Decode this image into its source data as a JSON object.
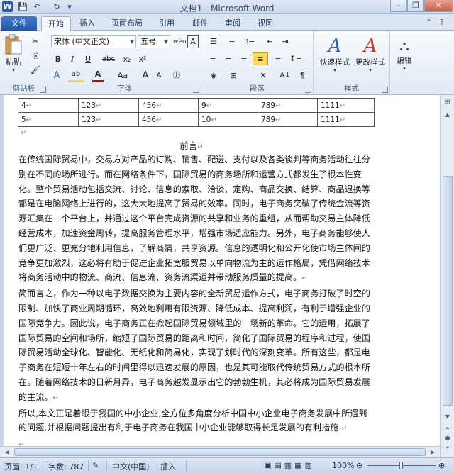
{
  "window": {
    "title": "文档1 - Microsoft Word",
    "logo": "W",
    "controls": {
      "minimize": "–",
      "restore": "❐",
      "close": "✕"
    }
  },
  "qat": {
    "save_icon": "💾",
    "undo_icon": "↶",
    "redo_icon": "↻",
    "customize_icon": "▾"
  },
  "tabs": [
    {
      "label": "文件"
    },
    {
      "label": "开始"
    },
    {
      "label": "插入"
    },
    {
      "label": "页面布局"
    },
    {
      "label": "引用"
    },
    {
      "label": "邮件"
    },
    {
      "label": "审阅"
    },
    {
      "label": "视图"
    }
  ],
  "ribbon": {
    "clipboard": {
      "label": "剪贴板",
      "paste": "粘贴",
      "cut_icon": "✂",
      "copy_icon": "⎘",
      "format_painter_icon": "🖌"
    },
    "font": {
      "label": "字体",
      "font_name": "宋体 (中文正文)",
      "font_size": "五号",
      "grow": "A",
      "shrink": "A",
      "pinyin": "wén",
      "char_border": "A",
      "bold": "B",
      "italic": "I",
      "underline": "U",
      "strike": "abc",
      "subscript": "x₂",
      "superscript": "x²",
      "highlight": "ab",
      "font_color": "A",
      "char_shade": "Aa",
      "enclose": "㊤"
    },
    "paragraph": {
      "label": "段落",
      "sort": "A↓",
      "show_marks": "¶"
    },
    "styles": {
      "label": "样式",
      "quick_styles": "快速样式",
      "change_styles": "更改样式"
    },
    "editing": {
      "label": "编辑",
      "find": "编辑"
    }
  },
  "table": {
    "rows": [
      [
        "4",
        "123",
        "456",
        "9",
        "789",
        "1111"
      ],
      [
        "5",
        "123",
        "456",
        "10",
        "789",
        "1111"
      ]
    ]
  },
  "document": {
    "heading": "前言",
    "paragraphs": [
      "在传统国际贸易中，交易方对产品的订购、销售、配送、支付以及各类谈判等商务活动往往分别在不同的场所进行。而在网络条件下，国际贸易的商务场所和运营方式都发生了根本性变化。整个贸易活动包括交流、讨论、信息的索取、洽谈、定购、商品交换、结算、商品退换等都是在电脑网络上进行的，这大大地提高了贸易的效率。同时，电子商务突破了传统金流等资源汇集在一个平台上，并通过这个平台完成资源的共享和业务的重组，从而帮助交易主体降低经营成本，加速资金周转，提高服务管理水平，增强市场适应能力。另外，电子商务能够使人们更广泛、更充分地利用信息，了解商情，共享资源。信息的透明化和公开化使市场主体间的竞争更加激烈，这必将有助于促进企业拓宽服贸易以单向物流为主的运作格局，凭借网络技术将商务活动中的物流、商流、信息流、资务流渠道并带动服务质量的提高。",
      "简而言之，作为一种以电子数据交换为主要内容的全新贸易运作方式，电子商务打破了时空的限制、加快了商业周期循环，高效地利用有限资源、降低成本、提高利润，有利于增强企业的国际竞争力。因此说，电子商务正在掀起国际贸易领域里的一场新的革命。它的运用，拓展了国际贸易的空间和场所，缩短了国际贸易的距离和时间，简化了国际贸易的程序和过程，使国际贸易活动全球化、智能化、无纸化和简易化，实现了划时代的深刻变革。所有这些，都是电子商务在短短十年左右的时间里得以迅速发展的原因，也是其可能取代传统贸易方式的根本所在。随着网络技术的日新月异，电子商务越发显示出它的勃勃生机，其必将成为国际贸易发展的主流。",
      "所以,本文正是着眼于我国的中小企业,全方位多角度分析中国中小企业电子商务发展中所遇到的问题,并根据问题提出有利于电子商务在我国中小企业能够取得长足发展的有利措施."
    ],
    "para_mark": "↵"
  },
  "statusbar": {
    "page": "页面: 1/1",
    "words": "字数: 787",
    "language": "中文(中国)",
    "mode": "插入",
    "zoom": "100%"
  },
  "colors": {
    "file_tab": "#2b5eaa",
    "ribbon_bg": "#e2eaf5",
    "doc_bg": "#c9d6e8"
  }
}
